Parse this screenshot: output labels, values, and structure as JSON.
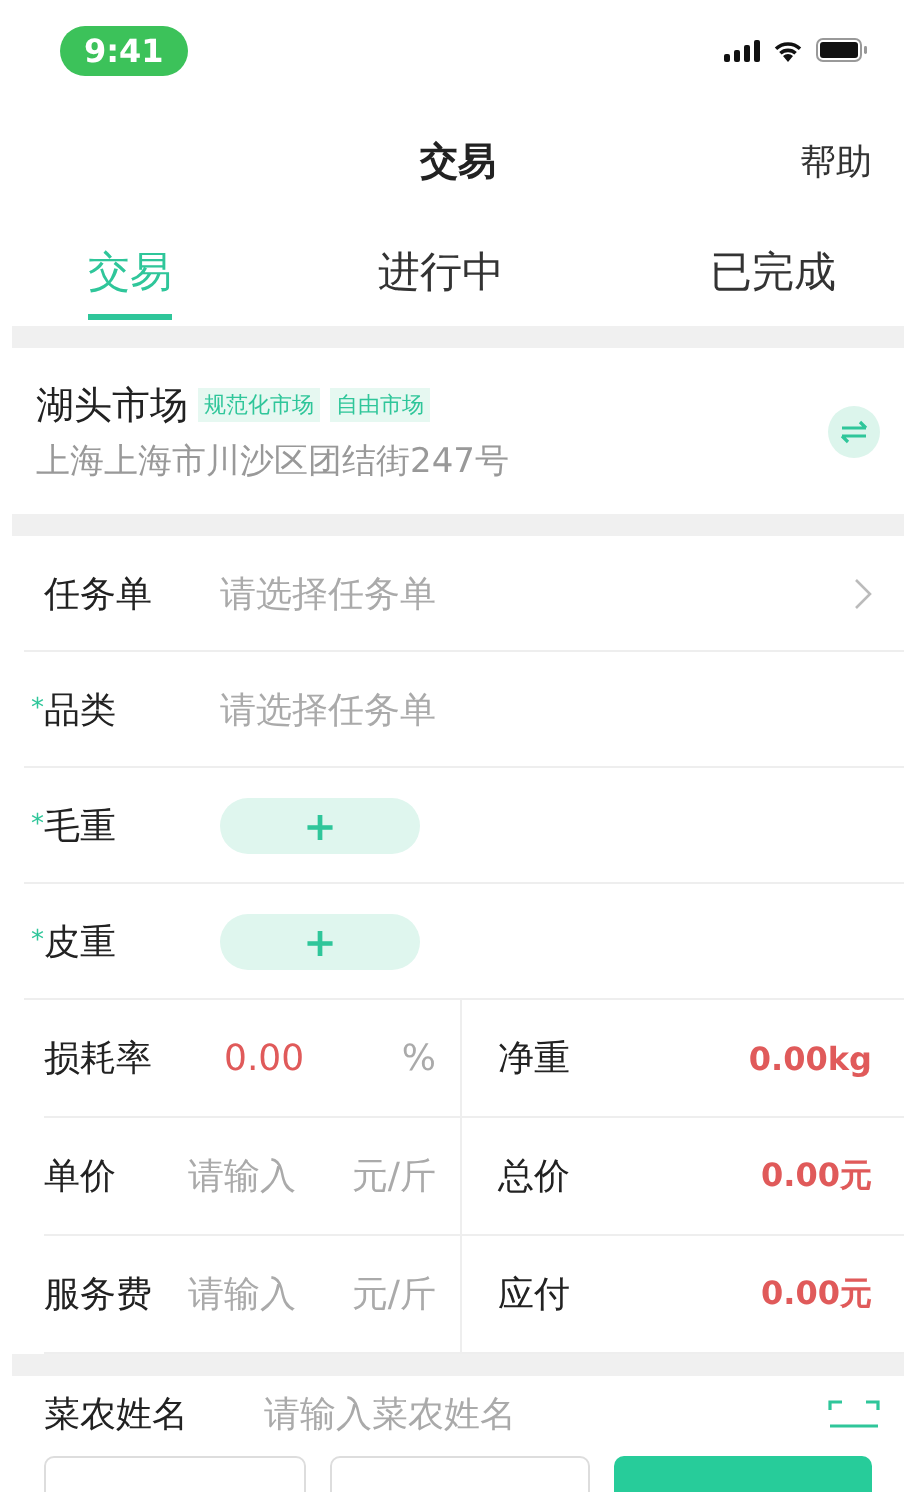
{
  "status_bar": {
    "time": "9:41"
  },
  "nav": {
    "title": "交易",
    "action": "帮助"
  },
  "tabs": [
    {
      "label": "交易",
      "selected": true
    },
    {
      "label": "进行中",
      "selected": false
    },
    {
      "label": "已完成",
      "selected": false
    }
  ],
  "market": {
    "name": "湖头市场",
    "tags": [
      "规范化市场",
      "自由市场"
    ],
    "address": "上海上海市川沙区团结街247号"
  },
  "form_rows": [
    {
      "kind": "select",
      "label": "任务单",
      "placeholder": "请选择任务单"
    },
    {
      "kind": "text",
      "mark": "*",
      "label": "品类",
      "placeholder": "请选择任务单"
    },
    {
      "kind": "add",
      "mark": "*",
      "label": "毛重",
      "button": "+"
    },
    {
      "kind": "add",
      "mark": "*",
      "label": "皮重",
      "button": "+"
    }
  ],
  "grid": [
    {
      "left": {
        "label": "损耗率",
        "value": "0.00",
        "unit": "%"
      },
      "right": {
        "label": "净重",
        "value": "0.00kg"
      }
    },
    {
      "left": {
        "label": "单价",
        "placeholder": "请输入",
        "unit": "元/斤"
      },
      "right": {
        "label": "总价",
        "value": "0.00元"
      }
    },
    {
      "left": {
        "label": "服务费",
        "placeholder": "请输入",
        "unit": "元/斤"
      },
      "right": {
        "label": "应付",
        "value": "0.00元"
      }
    }
  ],
  "farmer": {
    "label": "菜农姓名",
    "placeholder": "请输入菜农姓名"
  },
  "bottom_buttons": [
    {
      "kind": "outline"
    },
    {
      "kind": "outline"
    },
    {
      "kind": "primary"
    }
  ]
}
